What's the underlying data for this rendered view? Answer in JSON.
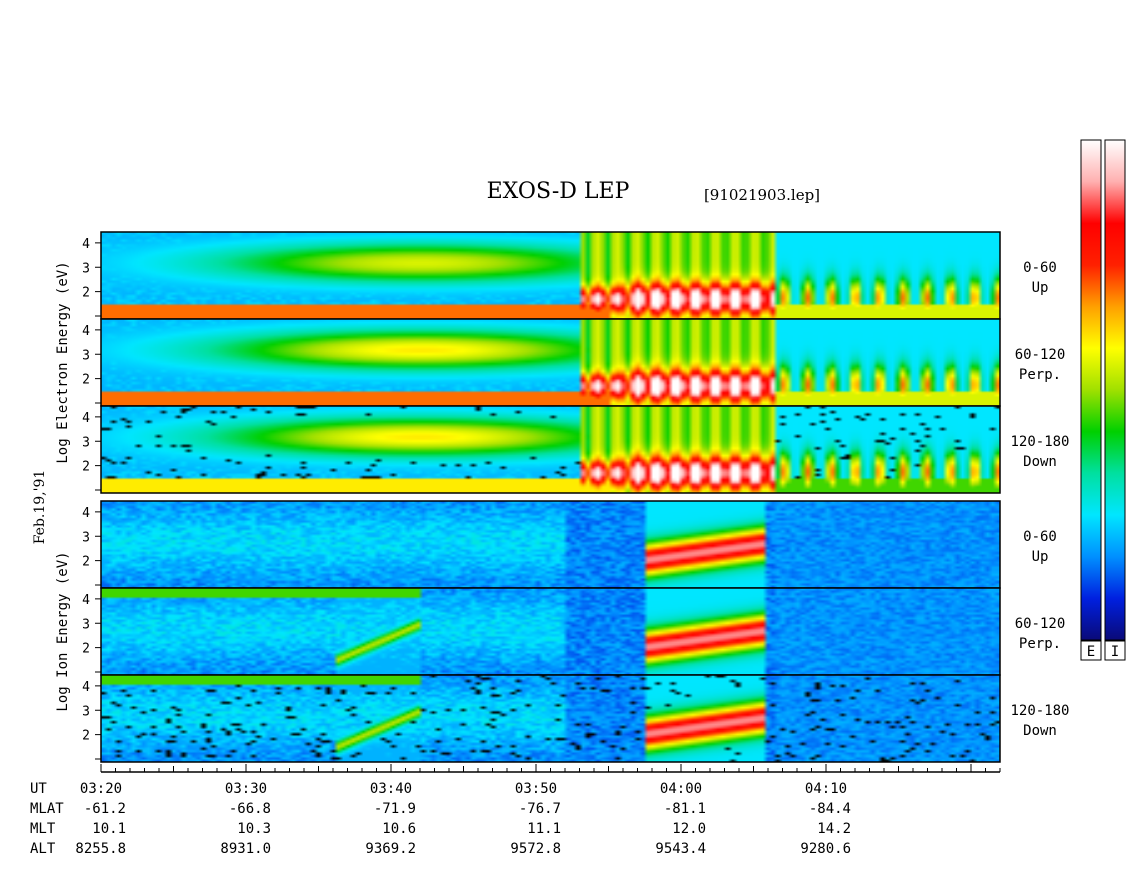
{
  "chart_data": {
    "type": "heatmap",
    "title": "EXOS-D LEP",
    "file_label": "[91021903.lep]",
    "date_label": "Feb.19,'91",
    "y_scale": "log",
    "y_ticks": [
      "1",
      "2",
      "3",
      "4"
    ],
    "groups": [
      {
        "name": "Electron",
        "ylabel": "Log  Electron  Energy (eV)",
        "panels": [
          {
            "label_top": "0-60",
            "label_bottom": "Up"
          },
          {
            "label_top": "60-120",
            "label_bottom": "Perp."
          },
          {
            "label_top": "120-180",
            "label_bottom": "Down"
          }
        ]
      },
      {
        "name": "Ion",
        "ylabel": "Log  Ion  Energy (eV)",
        "panels": [
          {
            "label_top": "0-60",
            "label_bottom": "Up"
          },
          {
            "label_top": "60-120",
            "label_bottom": "Perp."
          },
          {
            "label_top": "120-180",
            "label_bottom": "Down"
          }
        ]
      }
    ],
    "x_axis": {
      "unit": "UT",
      "range_minutes": [
        200,
        262
      ],
      "major_ticks": [
        200,
        210,
        220,
        230,
        240,
        250
      ]
    },
    "ephemeris": {
      "rows": [
        {
          "name": "UT",
          "values": [
            "03:20",
            "03:30",
            "03:40",
            "03:50",
            "04:00",
            "04:10"
          ]
        },
        {
          "name": "MLAT",
          "values": [
            "-61.2",
            "-66.8",
            "-71.9",
            "-76.7",
            "-81.1",
            "-84.4"
          ]
        },
        {
          "name": "MLT",
          "values": [
            "10.1",
            "10.3",
            "10.6",
            "11.1",
            "12.0",
            "14.2"
          ]
        },
        {
          "name": "ALT",
          "values": [
            "8255.8",
            "8931.0",
            "9369.2",
            "9572.8",
            "9543.4",
            "9280.6"
          ]
        }
      ]
    },
    "colorbars": [
      {
        "label": "E",
        "colors": [
          "#0a0a78",
          "#0020e0",
          "#0090ff",
          "#00e6ff",
          "#00e0a0",
          "#00d000",
          "#a0e000",
          "#ffff00",
          "#ffa000",
          "#ff2000",
          "#ff0000",
          "#ffb0b0",
          "#ffffff"
        ]
      },
      {
        "label": "I",
        "colors": [
          "#0a0a78",
          "#0020e0",
          "#0090ff",
          "#00e6ff",
          "#00e0a0",
          "#00d000",
          "#a0e000",
          "#ffff00",
          "#ffa000",
          "#ff2000",
          "#ff0000",
          "#ffb0b0",
          "#ffffff"
        ]
      }
    ]
  }
}
